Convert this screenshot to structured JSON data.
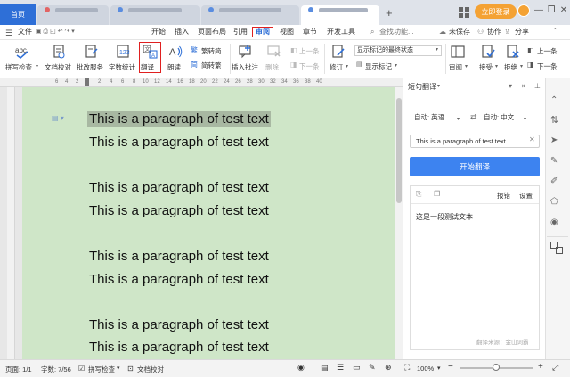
{
  "titlebar": {
    "home_tab": "首页",
    "login": "立即登录",
    "new_tab": "+"
  },
  "menubar": {
    "file": "文件",
    "items": [
      "开始",
      "插入",
      "页面布局",
      "引用",
      "审阅",
      "视图",
      "章节",
      "开发工具"
    ],
    "active": "审阅",
    "search": "查找功能...",
    "unsaved": "未保存",
    "collab": "协作",
    "share": "分享"
  },
  "ribbon": {
    "spell": "拼写检查",
    "proofread": "文档校对",
    "correction": "批改服务",
    "wordcount": "字数统计",
    "translate": "翻译",
    "read": "朗读",
    "trad": "繁转简",
    "simp": "简转繁",
    "insert_comment": "插入批注",
    "delete": "删除",
    "prev": "上一条",
    "next": "下一条",
    "markup_combo": "显示标记的最终状态",
    "show_markup": "显示标记",
    "revise": "修订",
    "review": "审阅",
    "accept": "接受",
    "reject": "拒绝",
    "prev2": "上一条",
    "next2": "下一条"
  },
  "ruler": {
    "marks": [
      "6",
      "4",
      "2",
      "2",
      "4",
      "6",
      "8",
      "10",
      "12",
      "14",
      "16",
      "18",
      "20",
      "22",
      "24",
      "26",
      "28",
      "30",
      "32",
      "34",
      "36",
      "38",
      "40"
    ]
  },
  "document": {
    "paragraphs": [
      "This is a paragraph of test text",
      "This is a paragraph of test text",
      "This is a paragraph of test text",
      "This is a paragraph of test text",
      "This is a paragraph of test text",
      "This is a paragraph of test text",
      "This is a paragraph of test text",
      "This is a paragraph of test text"
    ]
  },
  "panel": {
    "title": "短句翻译",
    "source_lang": "自动: 英语",
    "target_lang": "自动: 中文",
    "input": "This is a paragraph of test text",
    "translate_btn": "开始翻译",
    "report": "报错",
    "settings": "设置",
    "result": "这是一段测试文本",
    "source": "翻译来源：金山词霸"
  },
  "statusbar": {
    "page": "页面: 1/1",
    "wordcount": "字数: 7/56",
    "spell": "拼写检查",
    "proofread": "文档校对",
    "zoom": "100%"
  },
  "colors": {
    "accent": "#2e6fd7",
    "page_bg": "#cfe6c8",
    "login": "#f4a234",
    "highlight": "#e02020"
  }
}
